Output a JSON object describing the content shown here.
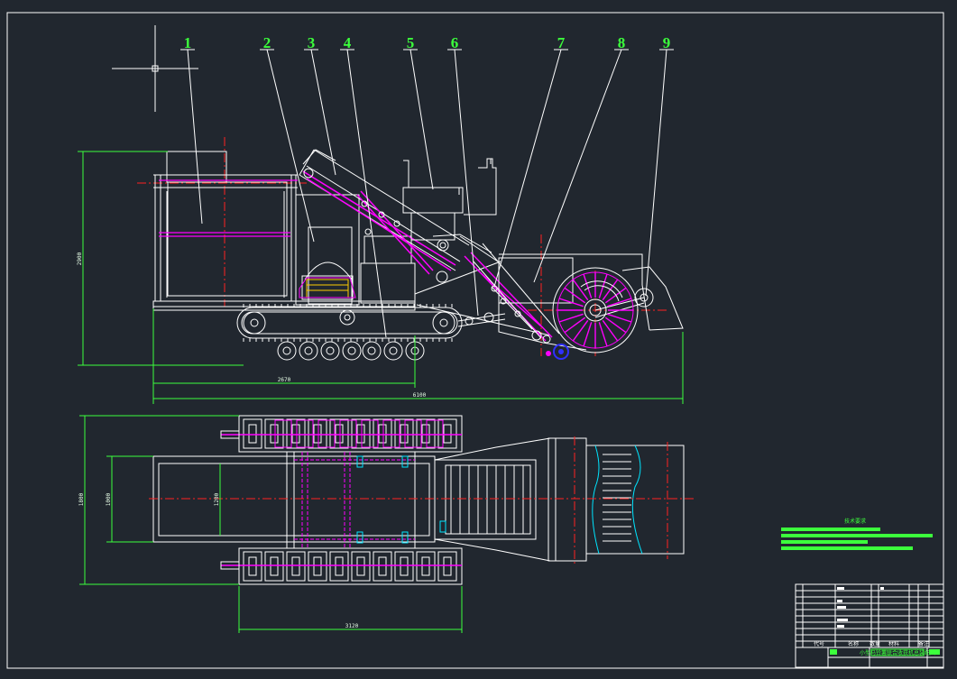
{
  "drawing": {
    "balloons": [
      "1",
      "2",
      "3",
      "4",
      "5",
      "6",
      "7",
      "8",
      "9"
    ],
    "dimensions": {
      "side_height": "2900",
      "track_length": "2670",
      "overall_length": "6100",
      "plan_width": "1800",
      "frame_width": "1000",
      "inner_width": "1200",
      "track_plan_length": "3120"
    },
    "notes": {
      "heading": "技术要求"
    },
    "title_block": {
      "code_label": "代号",
      "name_label": "名称",
      "qty_label": "数量",
      "material_label": "材料",
      "remark_label": "备注",
      "title_text": "小型马铃薯联合收获机总装配图"
    }
  },
  "colors": {
    "background": "#21272f",
    "outline": "#ffffff",
    "balloon_text": "#3cff3c",
    "dimension": "#3cff3c",
    "center_line": "#ff2020",
    "mechanism": "#ff00ff",
    "hidden": "#00e5ff",
    "bearing": "#3030ff"
  }
}
